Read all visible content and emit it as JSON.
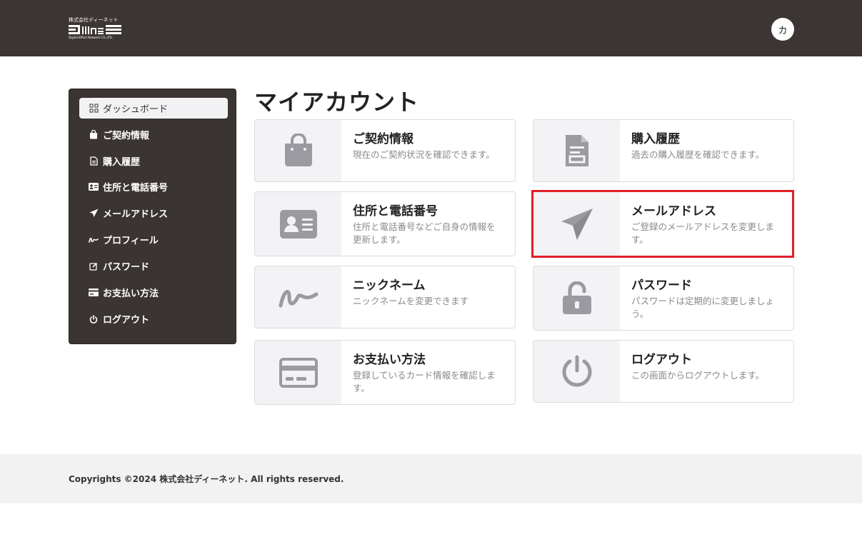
{
  "header": {
    "logo_company": "株式会社ディーネット",
    "logo_mark": "Deiinet",
    "logo_sub": "Digital-Effect Network CO.,LTD.",
    "avatar_initial": "カ"
  },
  "sidebar": {
    "items": [
      {
        "label": "ダッシュボード",
        "icon": "grid-icon",
        "active": true
      },
      {
        "label": "ご契約情報",
        "icon": "bag-icon"
      },
      {
        "label": "購入履歴",
        "icon": "document-icon"
      },
      {
        "label": "住所と電話番号",
        "icon": "id-card-icon"
      },
      {
        "label": "メールアドレス",
        "icon": "paper-plane-icon"
      },
      {
        "label": "プロフィール",
        "icon": "signature-icon"
      },
      {
        "label": "パスワード",
        "icon": "edit-icon"
      },
      {
        "label": "お支払い方法",
        "icon": "credit-card-icon"
      },
      {
        "label": "ログアウト",
        "icon": "power-icon"
      }
    ]
  },
  "main": {
    "title": "マイアカウント",
    "cards": [
      {
        "title": "ご契約情報",
        "desc": "現在のご契約状況を確認できます。",
        "icon": "bag-icon"
      },
      {
        "title": "購入履歴",
        "desc": "過去の購入履歴を確認できます。",
        "icon": "document-icon"
      },
      {
        "title": "住所と電話番号",
        "desc": "住所と電話番号などご自身の情報を更新します。",
        "icon": "id-card-icon"
      },
      {
        "title": "メールアドレス",
        "desc": "ご登録のメールアドレスを変更します。",
        "icon": "paper-plane-icon"
      },
      {
        "title": "ニックネーム",
        "desc": "ニックネームを変更できます",
        "icon": "signature-icon"
      },
      {
        "title": "パスワード",
        "desc": "パスワードは定期的に変更しましょう。",
        "icon": "unlock-icon"
      },
      {
        "title": "お支払い方法",
        "desc": "登録しているカード情報を確認します。",
        "icon": "credit-card-icon"
      },
      {
        "title": "ログアウト",
        "desc": "この画面からログアウトします。",
        "icon": "power-icon"
      }
    ]
  },
  "footer": {
    "copyright": "Copyrights ©2024 株式会社ディーネット. All rights reserved."
  },
  "colors": {
    "header_bg": "#3b3533",
    "sidebar_bg": "#3a3432",
    "highlight": "#e0202a",
    "icon_gray": "#9a9aa0"
  }
}
